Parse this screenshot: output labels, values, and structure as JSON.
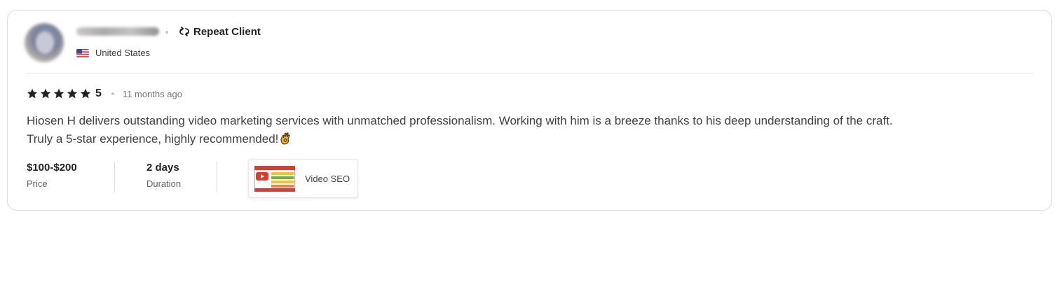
{
  "review": {
    "repeat_label": "Repeat Client",
    "country": "United States",
    "rating": "5",
    "stars": 5,
    "time_ago": "11 months ago",
    "text": "Hiosen H delivers outstanding video marketing services with unmatched professionalism. Working with him is a breeze thanks to his deep understanding of the craft. Truly a 5-star experience, highly recommended!",
    "price_value": "$100-$200",
    "price_label": "Price",
    "duration_value": "2 days",
    "duration_label": "Duration",
    "gig_title": "Video SEO"
  },
  "icons": {
    "repeat": "repeat-client-icon",
    "flag": "us-flag-icon",
    "star": "star-icon",
    "emoji": "ok-hand-emoji-icon"
  },
  "colors": {
    "text_primary": "#222325",
    "text_secondary": "#404145",
    "muted": "#74767e",
    "border": "#dadbdd"
  }
}
